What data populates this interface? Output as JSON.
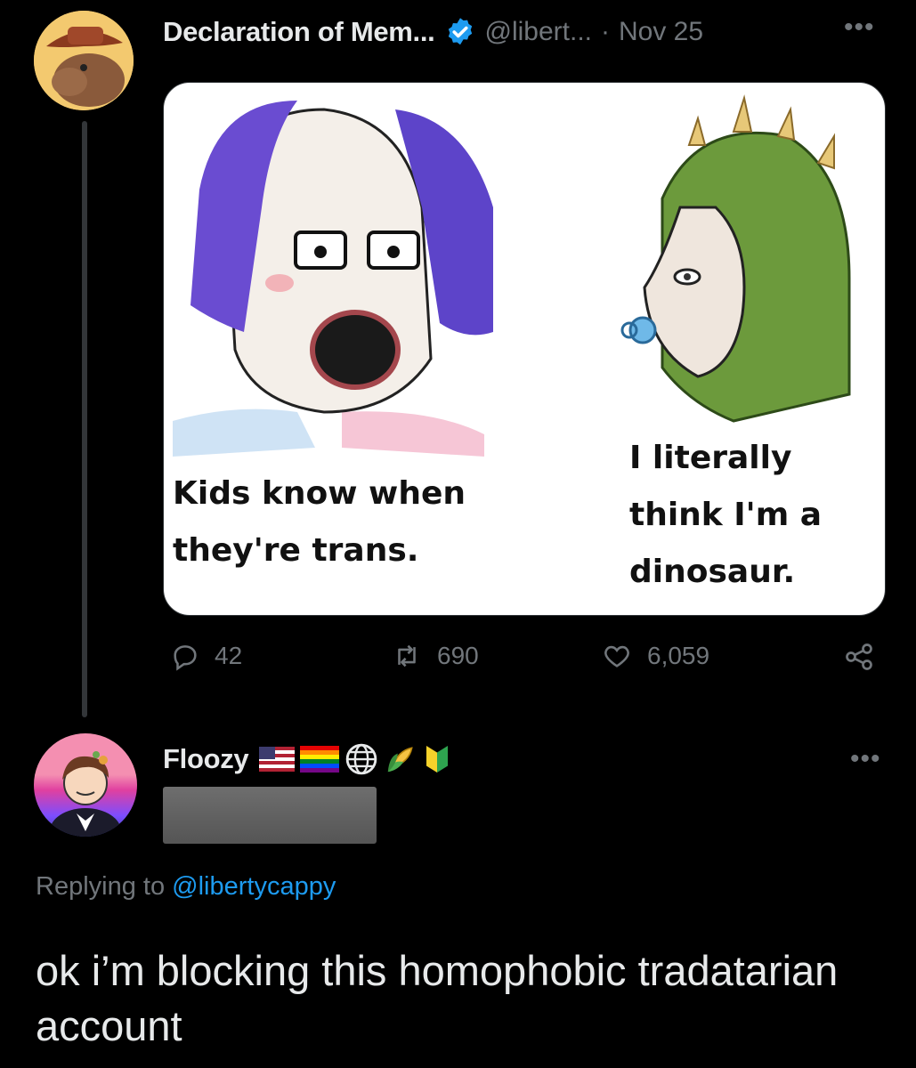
{
  "tweet": {
    "display_name": "Declaration of Mem...",
    "handle": "@libert...",
    "separator": "·",
    "date": "Nov 25",
    "media_captions": {
      "left": "Kids know when they're trans.",
      "right": "I literally think I'm a dinosaur."
    },
    "stats": {
      "replies": "42",
      "retweets": "690",
      "likes": "6,059"
    }
  },
  "reply": {
    "display_name": "Floozy",
    "replying_prefix": "Replying to",
    "replying_mention": "@libertycappy",
    "text": "ok i’m blocking this homophobic tradatarian account"
  },
  "colors": {
    "background": "#000000",
    "text": "#e7e9ea",
    "muted": "#71767b",
    "accent": "#1d9bf0"
  },
  "icons": [
    "verified-badge-icon",
    "more-icon",
    "reply-icon",
    "retweet-icon",
    "like-icon",
    "share-icon",
    "us-flag-icon",
    "pride-flag-icon",
    "globe-icon",
    "corn-icon",
    "beginner-shield-icon"
  ]
}
